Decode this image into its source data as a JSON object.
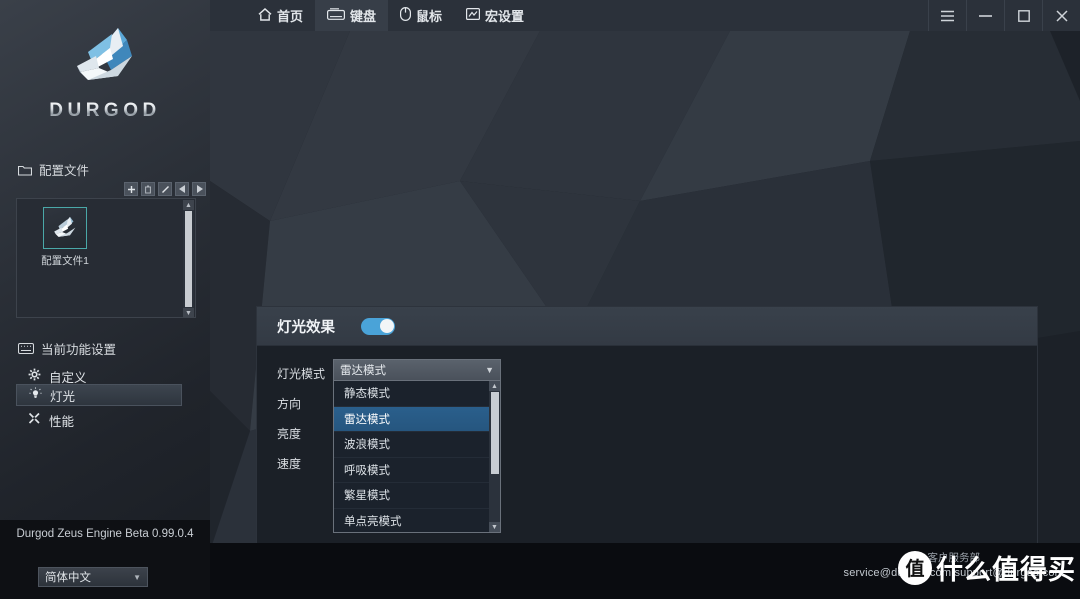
{
  "brand": {
    "name": "DURGOD",
    "logo_icon": "durgod-bird-logo"
  },
  "topbar": {
    "tabs": [
      {
        "label": "首页",
        "icon": "home-icon",
        "active": false
      },
      {
        "label": "键盘",
        "icon": "keyboard-icon",
        "active": true
      },
      {
        "label": "鼠标",
        "icon": "mouse-icon",
        "active": false
      },
      {
        "label": "宏设置",
        "icon": "macro-icon",
        "active": false
      }
    ],
    "window_controls": [
      {
        "name": "menu",
        "glyph": "☰"
      },
      {
        "name": "minimize",
        "glyph": "–"
      },
      {
        "name": "maximize",
        "glyph": "☐"
      },
      {
        "name": "close",
        "glyph": "✕"
      }
    ]
  },
  "sidebar": {
    "profiles_section": {
      "title": "配置文件",
      "icon": "folder-icon",
      "toolbar": [
        {
          "name": "add-profile",
          "glyph": "+"
        },
        {
          "name": "delete-profile",
          "glyph": "Ὕ1"
        },
        {
          "name": "edit-profile",
          "glyph": "/"
        },
        {
          "name": "prev-profile",
          "glyph": "◀"
        },
        {
          "name": "next-profile",
          "glyph": "▶"
        }
      ],
      "items": [
        {
          "label": "配置文件1",
          "icon": "durgod-bird-logo",
          "selected": true
        }
      ]
    },
    "settings_section": {
      "title": "当前功能设置",
      "icon": "keyboard-icon",
      "items": [
        {
          "label": "自定义",
          "icon": "gear-icon",
          "active": false
        },
        {
          "label": "灯光",
          "icon": "bulb-icon",
          "active": true
        },
        {
          "label": "性能",
          "icon": "wrench-icon",
          "active": false
        }
      ]
    },
    "version": "Durgod Zeus Engine Beta 0.99.0.4",
    "language": {
      "value": "简体中文",
      "caret": "▼"
    }
  },
  "panel": {
    "title": "灯光效果",
    "toggle_on": true,
    "accent_color": "#4aa3d8",
    "fields": [
      {
        "label": "灯光模式"
      },
      {
        "label": "方向"
      },
      {
        "label": "亮度"
      },
      {
        "label": "速度"
      }
    ],
    "mode_combo": {
      "value": "雷达模式",
      "caret": "▼",
      "expanded": true,
      "options": [
        {
          "label": "静态模式",
          "selected": false
        },
        {
          "label": "雷达模式",
          "selected": true
        },
        {
          "label": "波浪模式",
          "selected": false
        },
        {
          "label": "呼吸模式",
          "selected": false
        },
        {
          "label": "繁星模式",
          "selected": false
        },
        {
          "label": "单点亮模式",
          "selected": false
        }
      ],
      "scroll_up": "▲",
      "scroll_down": "▼"
    }
  },
  "footer": {
    "department": "客户服务部",
    "emails": "service@durgod.com    support@durgod.com"
  },
  "watermark": {
    "badge": "值",
    "text": "什么值得买"
  }
}
